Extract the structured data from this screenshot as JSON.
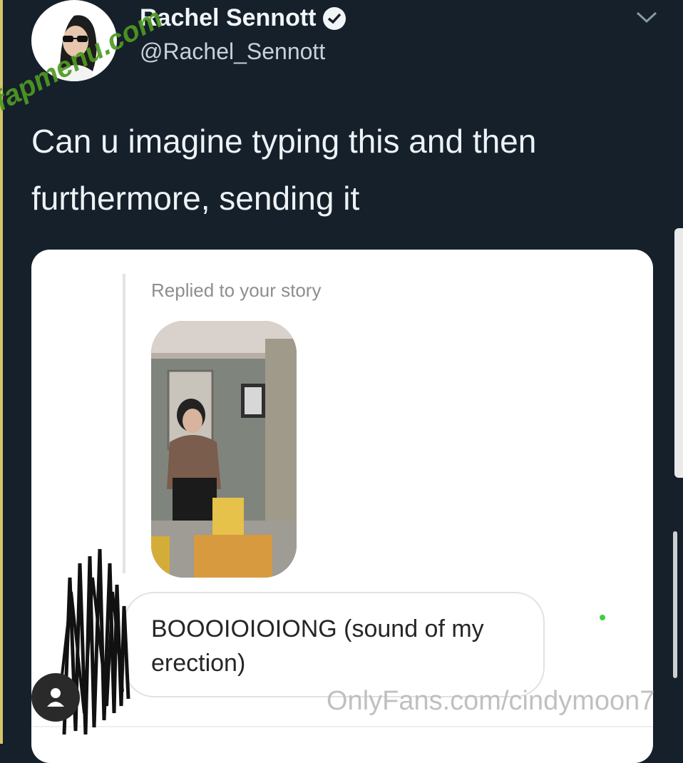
{
  "tweet": {
    "display_name": "Rachel Sennott",
    "handle": "@Rachel_Sennott",
    "verified_icon": "verified-badge-icon",
    "text": "Can u imagine typing this and then furthermore, sending it"
  },
  "dm": {
    "replied_label": "Replied to your story",
    "message": "BOOOIOIOIONG (sound of my erection)"
  },
  "watermarks": {
    "top": "fapmenu.com",
    "bottom": "OnlyFans.com/cindymoon7"
  },
  "colors": {
    "background": "#15202b",
    "card": "#ffffff",
    "watermark_green": "#4f9a22"
  }
}
